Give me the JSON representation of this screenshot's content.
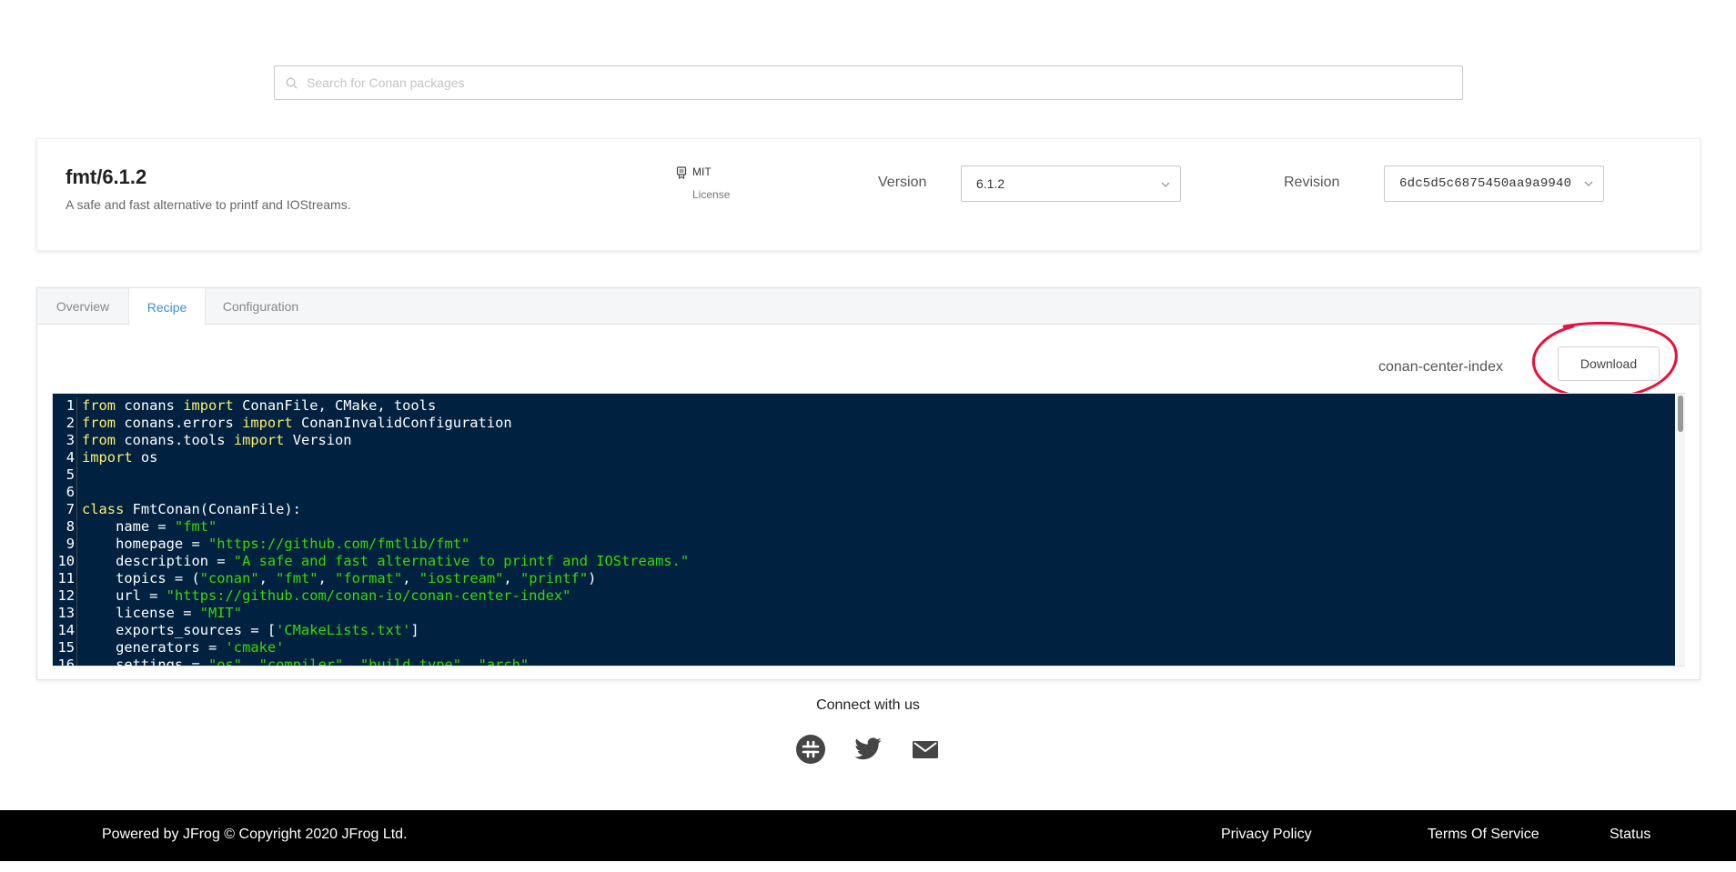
{
  "search": {
    "placeholder": "Search for Conan packages"
  },
  "package": {
    "title": "fmt/6.1.2",
    "description": "A safe and fast alternative to printf and IOStreams.",
    "license_value": "MIT",
    "license_label": "License",
    "version_label": "Version",
    "version_value": "6.1.2",
    "revision_label": "Revision",
    "revision_value": "6dc5d5c6875450aa9a9940"
  },
  "tabs": [
    {
      "label": "Overview",
      "active": false
    },
    {
      "label": "Recipe",
      "active": true
    },
    {
      "label": "Configuration",
      "active": false
    }
  ],
  "recipe": {
    "repo_name": "conan-center-index",
    "download_label": "Download",
    "annotation_color": "#e8103c",
    "code_lines": [
      [
        [
          "kw",
          "from"
        ],
        [
          "plain",
          " conans "
        ],
        [
          "kw",
          "import"
        ],
        [
          "plain",
          " ConanFile, CMake, tools"
        ]
      ],
      [
        [
          "kw",
          "from"
        ],
        [
          "plain",
          " conans.errors "
        ],
        [
          "kw",
          "import"
        ],
        [
          "plain",
          " ConanInvalidConfiguration"
        ]
      ],
      [
        [
          "kw",
          "from"
        ],
        [
          "plain",
          " conans.tools "
        ],
        [
          "kw",
          "import"
        ],
        [
          "plain",
          " Version"
        ]
      ],
      [
        [
          "kw",
          "import"
        ],
        [
          "plain",
          " os"
        ]
      ],
      [],
      [],
      [
        [
          "kw",
          "class"
        ],
        [
          "plain",
          " FmtConan(ConanFile):"
        ]
      ],
      [
        [
          "plain",
          "    name = "
        ],
        [
          "str",
          "\"fmt\""
        ]
      ],
      [
        [
          "plain",
          "    homepage = "
        ],
        [
          "str",
          "\"https://github.com/fmtlib/fmt\""
        ]
      ],
      [
        [
          "plain",
          "    description = "
        ],
        [
          "str",
          "\"A safe and fast alternative to printf and IOStreams.\""
        ]
      ],
      [
        [
          "plain",
          "    topics = ("
        ],
        [
          "str",
          "\"conan\""
        ],
        [
          "plain",
          ", "
        ],
        [
          "str",
          "\"fmt\""
        ],
        [
          "plain",
          ", "
        ],
        [
          "str",
          "\"format\""
        ],
        [
          "plain",
          ", "
        ],
        [
          "str",
          "\"iostream\""
        ],
        [
          "plain",
          ", "
        ],
        [
          "str",
          "\"printf\""
        ],
        [
          "plain",
          ")"
        ]
      ],
      [
        [
          "plain",
          "    url = "
        ],
        [
          "str",
          "\"https://github.com/conan-io/conan-center-index\""
        ]
      ],
      [
        [
          "plain",
          "    license = "
        ],
        [
          "str",
          "\"MIT\""
        ]
      ],
      [
        [
          "plain",
          "    exports_sources = ["
        ],
        [
          "str",
          "'CMakeLists.txt'"
        ],
        [
          "plain",
          "]"
        ]
      ],
      [
        [
          "plain",
          "    generators = "
        ],
        [
          "str",
          "'cmake'"
        ]
      ],
      [
        [
          "plain",
          "    settings = "
        ],
        [
          "str",
          "\"os\""
        ],
        [
          "plain",
          ", "
        ],
        [
          "str",
          "\"compiler\""
        ],
        [
          "plain",
          ", "
        ],
        [
          "str",
          "\"build_type\""
        ],
        [
          "plain",
          ", "
        ],
        [
          "str",
          "\"arch\""
        ]
      ]
    ]
  },
  "connect": {
    "heading": "Connect with us",
    "icons": [
      "slack-icon",
      "twitter-icon",
      "mail-icon"
    ]
  },
  "footer": {
    "copyright": "Powered by JFrog © Copyright 2020 JFrog Ltd.",
    "privacy": "Privacy Policy",
    "terms": "Terms Of Service",
    "status": "Status"
  },
  "colors": {
    "accent": "#3d8fd6",
    "code_bg": "#002240",
    "code_keyword": "#ffee66",
    "code_string": "#3ad900",
    "footer_bg": "#000000"
  }
}
